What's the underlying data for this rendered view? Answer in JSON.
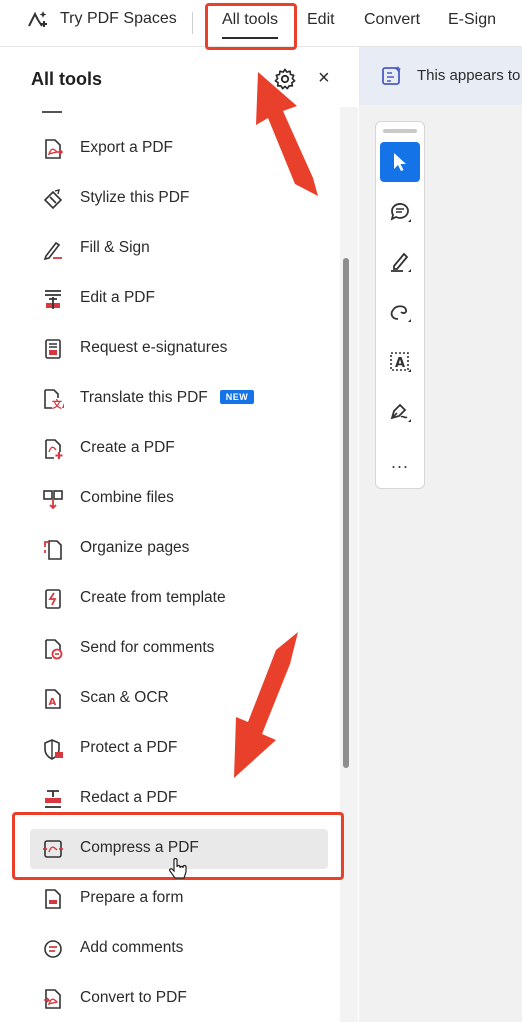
{
  "topbar": {
    "spaces_label": "Try PDF Spaces",
    "menu": [
      "All tools",
      "Edit",
      "Convert",
      "E-Sign"
    ]
  },
  "panel": {
    "title": "All tools",
    "tools": [
      {
        "label": "Export a PDF",
        "icon": "export-pdf-icon"
      },
      {
        "label": "Stylize this PDF",
        "icon": "stylize-icon"
      },
      {
        "label": "Fill & Sign",
        "icon": "fill-sign-icon"
      },
      {
        "label": "Edit a PDF",
        "icon": "edit-pdf-icon"
      },
      {
        "label": "Request e-signatures",
        "icon": "request-esign-icon"
      },
      {
        "label": "Translate this PDF",
        "icon": "translate-icon",
        "badge": "NEW"
      },
      {
        "label": "Create a PDF",
        "icon": "create-pdf-icon"
      },
      {
        "label": "Combine files",
        "icon": "combine-icon"
      },
      {
        "label": "Organize pages",
        "icon": "organize-icon"
      },
      {
        "label": "Create from template",
        "icon": "template-icon"
      },
      {
        "label": "Send for comments",
        "icon": "send-comments-icon"
      },
      {
        "label": "Scan & OCR",
        "icon": "scan-ocr-icon"
      },
      {
        "label": "Protect a PDF",
        "icon": "protect-icon"
      },
      {
        "label": "Redact a PDF",
        "icon": "redact-icon"
      },
      {
        "label": "Compress a PDF",
        "icon": "compress-icon",
        "selected": true
      },
      {
        "label": "Prepare a form",
        "icon": "prepare-form-icon"
      },
      {
        "label": "Add comments",
        "icon": "add-comments-icon"
      },
      {
        "label": "Convert to PDF",
        "icon": "convert-pdf-icon"
      }
    ]
  },
  "notice": {
    "text": "This appears to"
  },
  "toolbar": {
    "tools": [
      "select-pointer-icon",
      "comment-icon",
      "highlight-icon",
      "draw-freehand-icon",
      "text-box-icon",
      "sign-icon"
    ],
    "more": "..."
  },
  "colors": {
    "accent": "#1473e6",
    "annotation": "#e8402a",
    "red_icon": "#d7373f"
  }
}
